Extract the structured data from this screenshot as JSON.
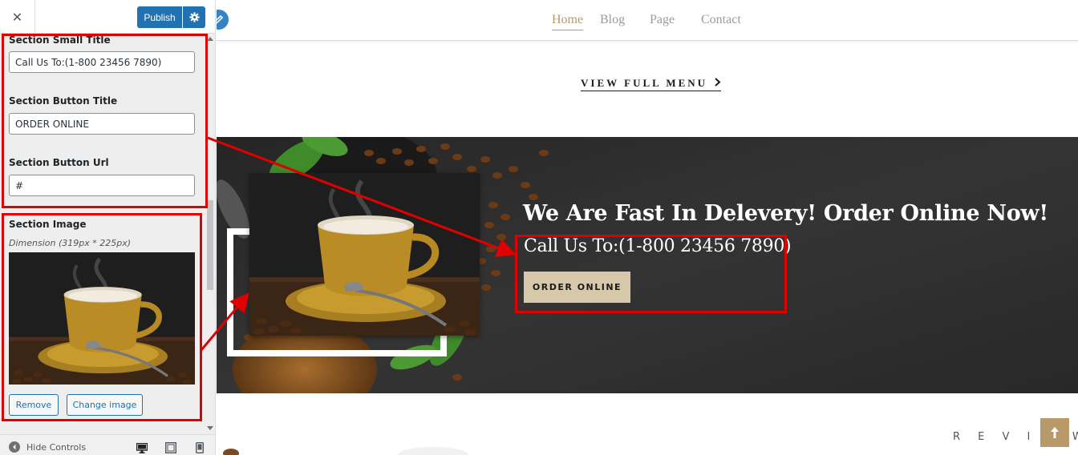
{
  "sidebar": {
    "close_symbol": "✕",
    "publish_label": "Publish",
    "fields": {
      "small_title": {
        "label": "Section Small Title",
        "value": "Call Us To:(1-800 23456 7890)"
      },
      "button_title": {
        "label": "Section Button Title",
        "value": "ORDER ONLINE"
      },
      "button_url": {
        "label": "Section Button Url",
        "value": "#"
      }
    },
    "image_section": {
      "label": "Section Image",
      "dimension_note": "Dimension (319px * 225px)",
      "remove_label": "Remove",
      "change_label": "Change image"
    },
    "footer": {
      "hide_controls_label": "Hide Controls",
      "devices": [
        "desktop-icon",
        "tablet-icon",
        "mobile-icon"
      ]
    }
  },
  "preview": {
    "nav": [
      "Home",
      "Blog",
      "Page",
      "Contact"
    ],
    "active_nav": "Home",
    "view_menu_label": "VIEW FULL MENU",
    "banner": {
      "headline": "We Are Fast In Delevery! Order Online Now!",
      "small_title": "Call Us To:(1-800 23456 7890)",
      "button_label": "ORDER ONLINE"
    },
    "reviews_label": "R E V I E W"
  },
  "colors": {
    "publish_blue": "#2271b1",
    "accent_gold": "#b8996a",
    "button_beige": "#d8c8aa",
    "highlight_red": "#e00000"
  }
}
